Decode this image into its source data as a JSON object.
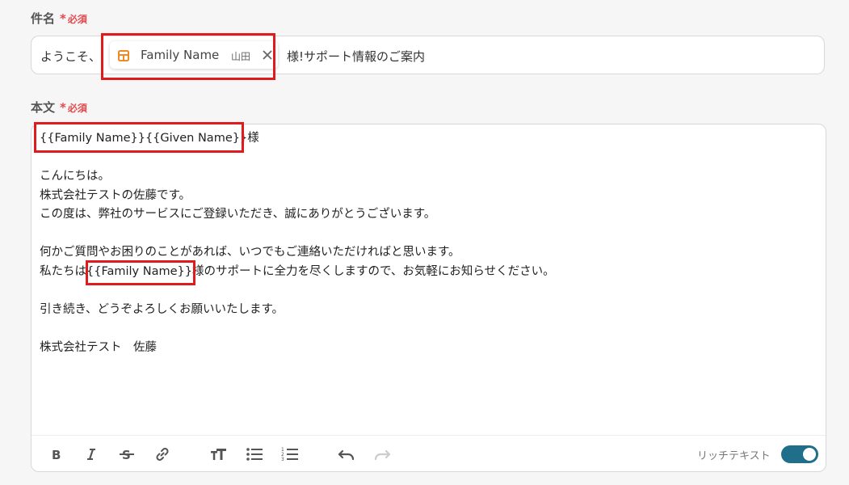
{
  "subject": {
    "label": "件名",
    "required_label": "必須",
    "prefix": "ようこそ、",
    "chip": {
      "icon": "table-icon",
      "label": "Family Name",
      "value": "山田"
    },
    "suffix": "様!サポート情報のご案内"
  },
  "body": {
    "label": "本文",
    "required_label": "必須",
    "lines": [
      "{{Family Name}}{{Given Name}}様",
      "",
      "こんにちは。",
      "株式会社テストの佐藤です。",
      "この度は、弊社のサービスにご登録いただき、誠にありがとうございます。",
      "",
      "何かご質問やお困りのことがあれば、いつでもご連絡いただければと思います。",
      "私たちは{{Family Name}}様のサポートに全力を尽くしますので、お気軽にお知らせください。",
      "",
      "引き続き、どうぞよろしくお願いいたします。",
      "",
      "株式会社テスト　佐藤"
    ]
  },
  "toolbar": {
    "buttons": [
      "bold-icon",
      "italic-icon",
      "strikethrough-icon",
      "link-icon",
      "text-size-icon",
      "bullet-list-icon",
      "numbered-list-icon",
      "undo-icon",
      "redo-icon"
    ],
    "rich_text_label": "リッチテキスト",
    "rich_text_enabled": true
  },
  "colors": {
    "required": "#e5484d",
    "highlight": "#e01b1b",
    "toggle": "#1f6f8b",
    "chip_icon": "#f08a24"
  }
}
